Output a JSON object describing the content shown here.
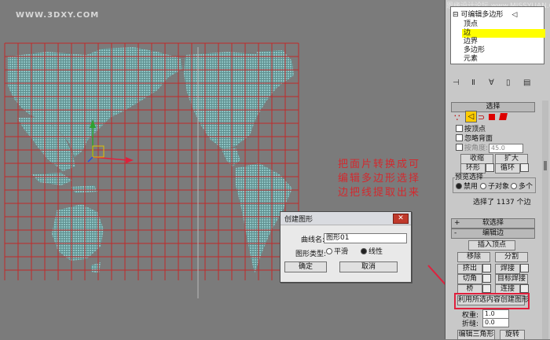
{
  "watermark": "WWW.3DXY.COM",
  "top_mark": "恩缘设计论坛 www.MISSYUAN.COM",
  "annotation": [
    "把面片转换成可",
    "编辑多边形选择",
    "边把线提取出来"
  ],
  "modifier_stack": {
    "root": "可编辑多边形",
    "items": [
      "顶点",
      "边",
      "边界",
      "多边形",
      "元素"
    ],
    "selected_index": 1,
    "selection_color": "#ffff00"
  },
  "selection_rollout": {
    "title": "选择",
    "by_vertex": "按顶点",
    "ignore_backfacing": "忽略背面",
    "by_angle": "按角度:",
    "angle_value": "45.0",
    "shrink": "收缩",
    "grow": "扩大",
    "ring": "环形",
    "loop": "循环",
    "preview_label": "预览选择",
    "preview_options": [
      "禁用",
      "子对象",
      "多个"
    ],
    "preview_selected": 0,
    "status": "选择了 1137 个边"
  },
  "soft_selection": {
    "title": "软选择"
  },
  "edit_edges": {
    "title": "编辑边",
    "insert_vertex": "插入顶点",
    "remove": "移除",
    "split": "分割",
    "extrude": "挤出",
    "weld": "焊接",
    "chamfer": "切角",
    "target_weld": "目标焊接",
    "bridge": "桥",
    "connect": "连接",
    "create_shape": "利用所选内容创建图形",
    "weight_label": "权重:",
    "weight_value": "1.0",
    "crease_label": "折缝:",
    "crease_value": "0.0",
    "edit_tri": "编辑三角形",
    "turn": "旋转"
  },
  "dialog": {
    "title": "创建图形",
    "curve_name_label": "曲线名:",
    "curve_name_value": "图形01",
    "shape_type_label": "图形类型:",
    "smooth": "平滑",
    "linear": "线性",
    "shape_selected": "linear",
    "ok": "确定",
    "cancel": "取消",
    "close_symbol": "✕"
  },
  "colors": {
    "grid": "#c22a2a",
    "land": "#8ec3c3",
    "accent_red": "#e0203d",
    "annotation": "#d3292e"
  }
}
